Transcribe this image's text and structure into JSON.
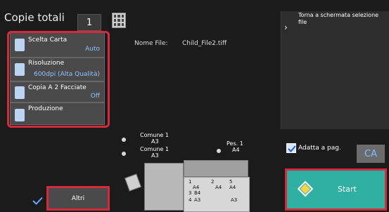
{
  "header": {
    "copies_label": "Copie totali",
    "copies_value": "1"
  },
  "settings": {
    "paper": {
      "title": "Scelta Carta",
      "value": "Auto"
    },
    "resolution": {
      "title": "Risoluzione",
      "value": "600dpi (Alta Qualità)"
    },
    "duplex": {
      "title": "Copia A 2 Facciate",
      "value": "Off"
    },
    "production": {
      "title": "Produzione"
    }
  },
  "file": {
    "label": "Nome File:",
    "name": "Child_File2.tiff"
  },
  "right_panel": {
    "return_text": "Torna a schermata selezione file"
  },
  "options": {
    "fit_page_label": "Adatta a pag."
  },
  "buttons": {
    "ca": "CA",
    "start": "Start",
    "more": "Altri"
  },
  "machine": {
    "tray1_label": "Comune 1",
    "tray1_size": "A3",
    "tray2_label": "Comune 1",
    "tray2_size": "A3",
    "bypass_label": "Pes. 1",
    "bypass_size": "A4",
    "drawers": [
      {
        "num": "1",
        "size": "A4"
      },
      {
        "num": "2",
        "size": "A4"
      },
      {
        "num": "3",
        "size": "B4"
      },
      {
        "num": "4",
        "size": "A3"
      },
      {
        "num": "5",
        "size": "A4"
      },
      {
        "num": "",
        "size": "A3"
      }
    ]
  },
  "colors": {
    "highlight": "#d42b3c",
    "start_button": "#2fb0a3",
    "accent_text": "#8ec2ff"
  }
}
